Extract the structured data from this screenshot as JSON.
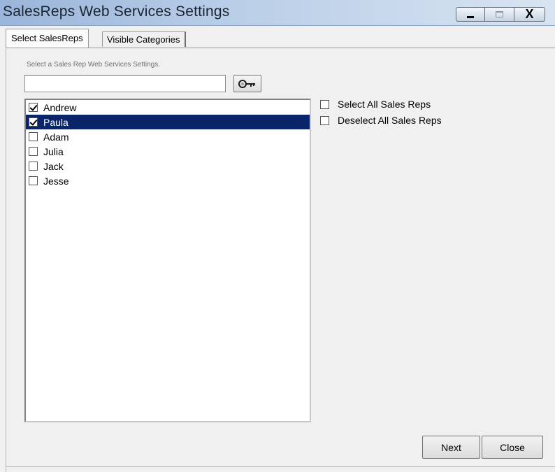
{
  "window": {
    "title": "SalesReps Web Services Settings",
    "controls": {
      "minimize": "_",
      "maximize": "□",
      "close": "X"
    }
  },
  "tabs": [
    {
      "label": "Select SalesReps",
      "active": true
    },
    {
      "label": "Visible Categories",
      "active": false
    }
  ],
  "search": {
    "hint": "Select a Sales Rep Web Services Settings.",
    "value": "",
    "placeholder": "",
    "button_icon": "search-key-icon"
  },
  "sales_reps": [
    {
      "name": "Andrew",
      "checked": true,
      "selected": false
    },
    {
      "name": "Paula",
      "checked": true,
      "selected": true
    },
    {
      "name": "Adam",
      "checked": false,
      "selected": false
    },
    {
      "name": "Julia",
      "checked": false,
      "selected": false
    },
    {
      "name": "Jack",
      "checked": false,
      "selected": false
    },
    {
      "name": "Jesse",
      "checked": false,
      "selected": false
    }
  ],
  "options": {
    "select_all": "Select All Sales Reps",
    "deselect_all": "Deselect All Sales Reps"
  },
  "buttons": {
    "next": "Next",
    "close": "Close"
  },
  "colors": {
    "selection": "#0a246a",
    "title_bar": "#b8cde7"
  }
}
